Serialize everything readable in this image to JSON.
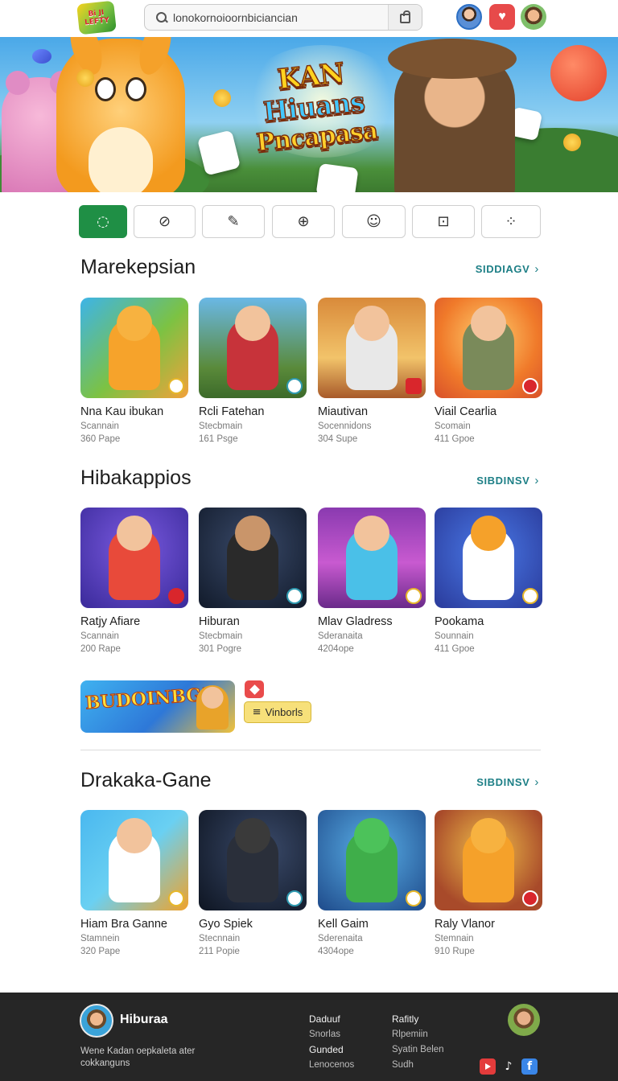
{
  "header": {
    "logo_text": "Bi JI LEFTY",
    "search_value": "lonokornoioornbiciancian",
    "search_placeholder": "lonokornoioornbiciancian",
    "icons": [
      "search-icon",
      "shopping-bag-icon",
      "avatar-icon",
      "heart-icon",
      "avatar-icon"
    ]
  },
  "hero": {
    "title_lines": [
      "KAN",
      "Hiuans",
      "Pncapasa"
    ]
  },
  "categories": [
    {
      "icon": "home-icon",
      "active": true
    },
    {
      "icon": "compass-icon",
      "active": false
    },
    {
      "icon": "feather-icon",
      "active": false
    },
    {
      "icon": "plus-circle-icon",
      "active": false
    },
    {
      "icon": "user-icon",
      "active": false
    },
    {
      "icon": "square-dot-icon",
      "active": false
    },
    {
      "icon": "grid-icon",
      "active": false
    }
  ],
  "sections": [
    {
      "title": "Marekepsian",
      "see_all": "SIDDIAGV",
      "items": [
        {
          "name": "Nna Kau ibukan",
          "sub": "Scannain",
          "meta": "360 Pape"
        },
        {
          "name": "Rcli Fatehan",
          "sub": "Stecbmain",
          "meta": "161 Psge"
        },
        {
          "name": "Miautivan",
          "sub": "Socennidons",
          "meta": "304 Supe"
        },
        {
          "name": "Viail Cearlia",
          "sub": "Scomain",
          "meta": "411 Gpoe"
        }
      ]
    },
    {
      "title": "Hibakappios",
      "see_all": "SIBDINSV",
      "items": [
        {
          "name": "Ratjy Afiare",
          "sub": "Scannain",
          "meta": "200 Rape"
        },
        {
          "name": "Hiburan",
          "sub": "Stecbmain",
          "meta": "301 Pogre"
        },
        {
          "name": "Mlav Gladress",
          "sub": "Sderanaita",
          "meta": "4204ope"
        },
        {
          "name": "Pookama",
          "sub": "Sounnain",
          "meta": "411 Gpoe"
        }
      ]
    },
    {
      "title": "Drakaka-Gane",
      "see_all": "SIBDINSV",
      "items": [
        {
          "name": "Hiam Bra Ganne",
          "sub": "Stamnein",
          "meta": "320 Pape"
        },
        {
          "name": "Gyo Spiek",
          "sub": "Stecnnain",
          "meta": "211 Popie"
        },
        {
          "name": "Kell Gaim",
          "sub": "Sderenaita",
          "meta": "4304ope"
        },
        {
          "name": "Raly Vlanor",
          "sub": "Stemnain",
          "meta": "910 Rupe"
        }
      ]
    }
  ],
  "promo": {
    "banner_text": "BUDOINBG!",
    "button_label": "Vinborls",
    "button_icon": "menu-icon",
    "chip_icon": "diamond-icon"
  },
  "footer": {
    "brand": "Hiburaa",
    "description": "Wene Kadan oepkaleta ater cokkanguns",
    "col1": [
      "Daduuf",
      "Snorlas",
      "Gunded",
      "Lenocenos"
    ],
    "col2": [
      "Rafitly",
      "Rlpemiin",
      "Syatin Belen",
      "Sudh"
    ],
    "social_icons": [
      "youtube-icon",
      "tiktok-icon",
      "facebook-icon"
    ]
  },
  "colors": {
    "accent_green": "#1f8f45",
    "see_all_teal": "#1d7f86",
    "footer_bg": "#262626",
    "promo_button": "#f7e07a"
  }
}
